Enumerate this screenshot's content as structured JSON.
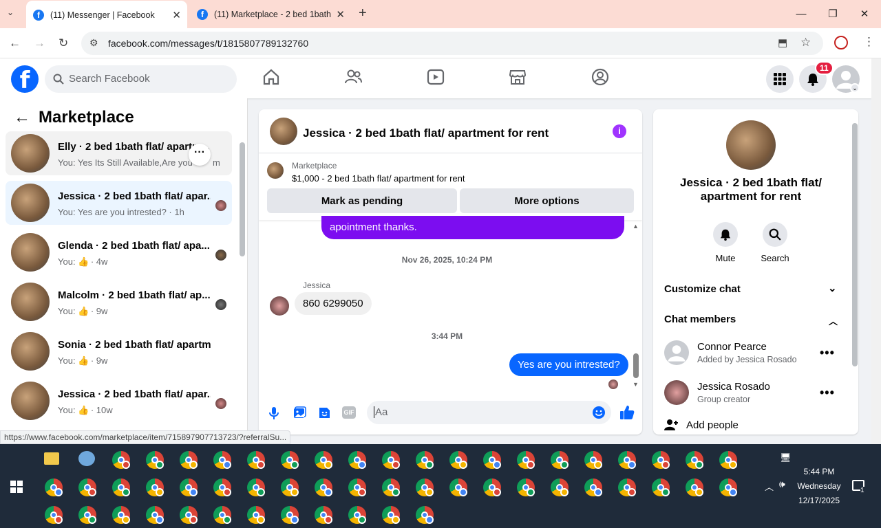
{
  "browser": {
    "tabs": [
      {
        "label": "(11) Messenger | Facebook",
        "active": true
      },
      {
        "label": "(11) Marketplace - 2 bed 1bath",
        "active": false
      }
    ],
    "url": "facebook.com/messages/t/1815807789132760",
    "status_link": "https://www.facebook.com/marketplace/item/715897907713723/?referralSu..."
  },
  "fbnav": {
    "search_placeholder": "Search Facebook",
    "notifications_badge": "11"
  },
  "sidebar": {
    "title": "Marketplace",
    "conversations": [
      {
        "name": "Elly · 2 bed 1bath flat/ apartm...",
        "preview": "You: Yes Its Still Available,Are you",
        "time": "m",
        "selected": false,
        "hover": true
      },
      {
        "name": "Jessica · 2 bed 1bath flat/ apar...",
        "preview": "You: Yes are you intrested? · 1h",
        "time": "",
        "selected": true
      },
      {
        "name": "Glenda · 2 bed 1bath flat/ apa...",
        "preview_prefix": "You:",
        "time": "· 4w"
      },
      {
        "name": "Malcolm · 2 bed 1bath flat/ ap...",
        "preview_prefix": "You:",
        "time": "· 9w"
      },
      {
        "name": "Sonia · 2 bed 1bath flat/ apartm...",
        "preview_prefix": "You:",
        "time": "· 9w"
      },
      {
        "name": "Jessica · 2 bed 1bath flat/ apar...",
        "preview_prefix": "You:",
        "time": "· 10w"
      }
    ]
  },
  "chat": {
    "title": "Jessica · 2 bed 1bath flat/ apartment for rent",
    "marketplace_label": "Marketplace",
    "listing": "$1,000 - 2 bed 1bath flat/ apartment for rent",
    "mark_pending": "Mark as pending",
    "more_options": "More options",
    "partial_message": "apointment thanks.",
    "ts1": "Nov 26, 2025, 10:24 PM",
    "sender": "Jessica",
    "incoming_message": "860 6299050",
    "ts2": "3:44 PM",
    "outgoing_message": "Yes are you intrested?",
    "composer_placeholder": "Aa"
  },
  "details": {
    "title_line1": "Jessica · 2 bed 1bath flat/",
    "title_line2": "apartment for rent",
    "mute": "Mute",
    "search": "Search",
    "customize": "Customize chat",
    "members_heading": "Chat members",
    "members": [
      {
        "name": "Connor Pearce",
        "sub": "Added by Jessica Rosado"
      },
      {
        "name": "Jessica Rosado",
        "sub": "Group creator"
      }
    ],
    "add_people": "Add people"
  },
  "taskbar": {
    "time": "5:44 PM",
    "day": "Wednesday",
    "date": "12/17/2025",
    "notif_count": "1"
  },
  "colors": {
    "fb_blue": "#0866ff",
    "bubble_purple": "#7c0df0",
    "info_purple": "#a033ff",
    "badge_red": "#e41e3f"
  }
}
